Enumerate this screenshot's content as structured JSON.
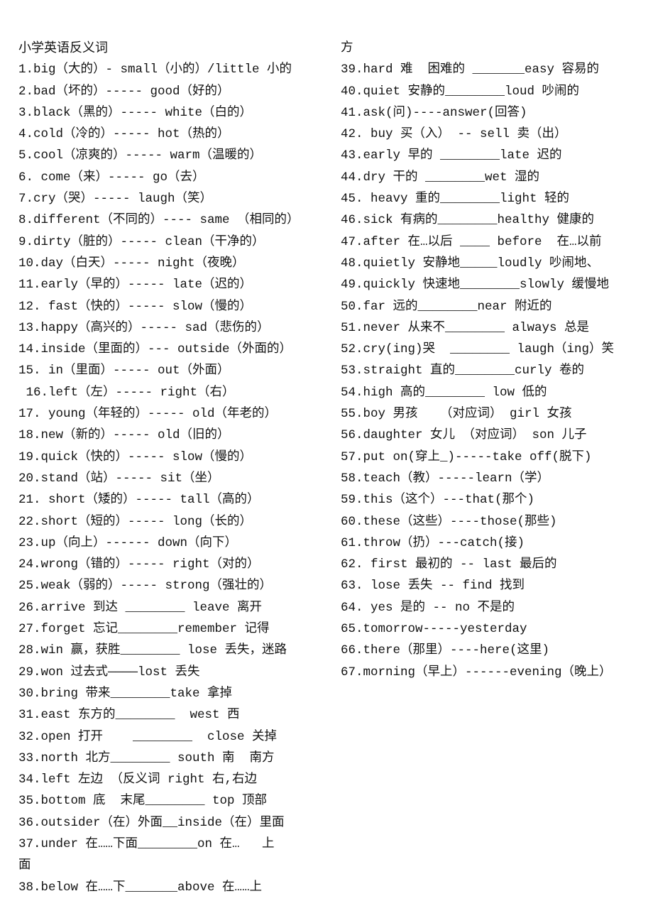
{
  "document": {
    "title": "小学英语反义词",
    "left_column": [
      "1.big（大的）- small（小的）/little 小的",
      "2.bad（坏的）----- good（好的）",
      "3.black（黑的）----- white（白的）",
      "4.cold（冷的）----- hot（热的）",
      "5.cool（凉爽的）----- warm（温暖的）",
      "6. come（来）----- go（去）",
      "7.cry（哭）----- laugh（笑）",
      "8.different（不同的）---- same （相同的）",
      "9.dirty（脏的）----- clean（干净的）",
      "10.day（白天）----- night（夜晚）",
      "11.early（早的）----- late（迟的）",
      "12. fast（快的）----- slow（慢的）",
      "13.happy（高兴的）----- sad（悲伤的）",
      "14.inside（里面的）--- outside（外面的）",
      "15. in（里面）----- out（外面）",
      " 16.left（左）----- right（右）",
      "17. young（年轻的）----- old（年老的）",
      "18.new（新的）----- old（旧的）",
      "19.quick（快的）----- slow（慢的）",
      "20.stand（站）----- sit（坐）",
      "21. short（矮的）----- tall（高的）",
      "22.short（短的）----- long（长的）",
      "23.up（向上）------ down（向下）",
      "24.wrong（错的）----- right（对的）",
      "25.weak（弱的）----- strong（强壮的）",
      "26.arrive 到达 ________ leave 离开",
      "27.forget 忘记________remember 记得",
      "28.win 赢，获胜________ lose 丢失，迷路",
      "29.won 过去式————lost 丢失",
      "30.bring 带来________take 拿掉",
      "31.east 东方的________  west 西",
      "32.open 打开    ________  close 关掉",
      "33.north 北方________ south 南  南方",
      "34.left 左边 （反义词 right 右,右边",
      "35.bottom 底  末尾________ top 顶部",
      "36.outsider（在）外面__inside（在）里面",
      "37.under 在……下面________on 在…   上",
      "面",
      "38.below 在……下_______above 在……上"
    ],
    "right_column": [
      "方",
      "39.hard 难  困难的 _______easy 容易的",
      "40.quiet 安静的________loud 吵闹的",
      "41.ask(问)----answer(回答)",
      "42. buy 买（入） -- sell 卖（出）",
      "43.early 早的 ________late 迟的",
      "44.dry 干的 ________wet 湿的",
      "45. heavy 重的________light 轻的",
      "46.sick 有病的________healthy 健康的",
      "47.after 在…以后 ____ before  在…以前",
      "48.quietly 安静地_____loudly 吵闹地、",
      "49.quickly 快速地________slowly 缓慢地",
      "50.far 远的________near 附近的",
      "51.never 从来不________ always 总是",
      "52.cry(ing)哭  ________ laugh（ing）笑",
      "53.straight 直的________curly 卷的",
      "54.high 高的________ low 低的",
      "55.boy 男孩   （对应词） girl 女孩",
      "56.daughter 女儿 （对应词） son 儿子",
      "57.put on(穿上_)-----take off(脱下)",
      "58.teach（教）-----learn（学）",
      "59.this（这个）---that(那个)",
      "60.these（这些）----those(那些)",
      "61.throw（扔）---catch(接)",
      "62. first 最初的 -- last 最后的",
      "63. lose 丢失 -- find 找到",
      "64. yes 是的 -- no 不是的",
      "65.tomorrow-----yesterday",
      "66.there（那里）----here(这里)",
      "67.morning（早上）------evening（晚上）"
    ]
  }
}
